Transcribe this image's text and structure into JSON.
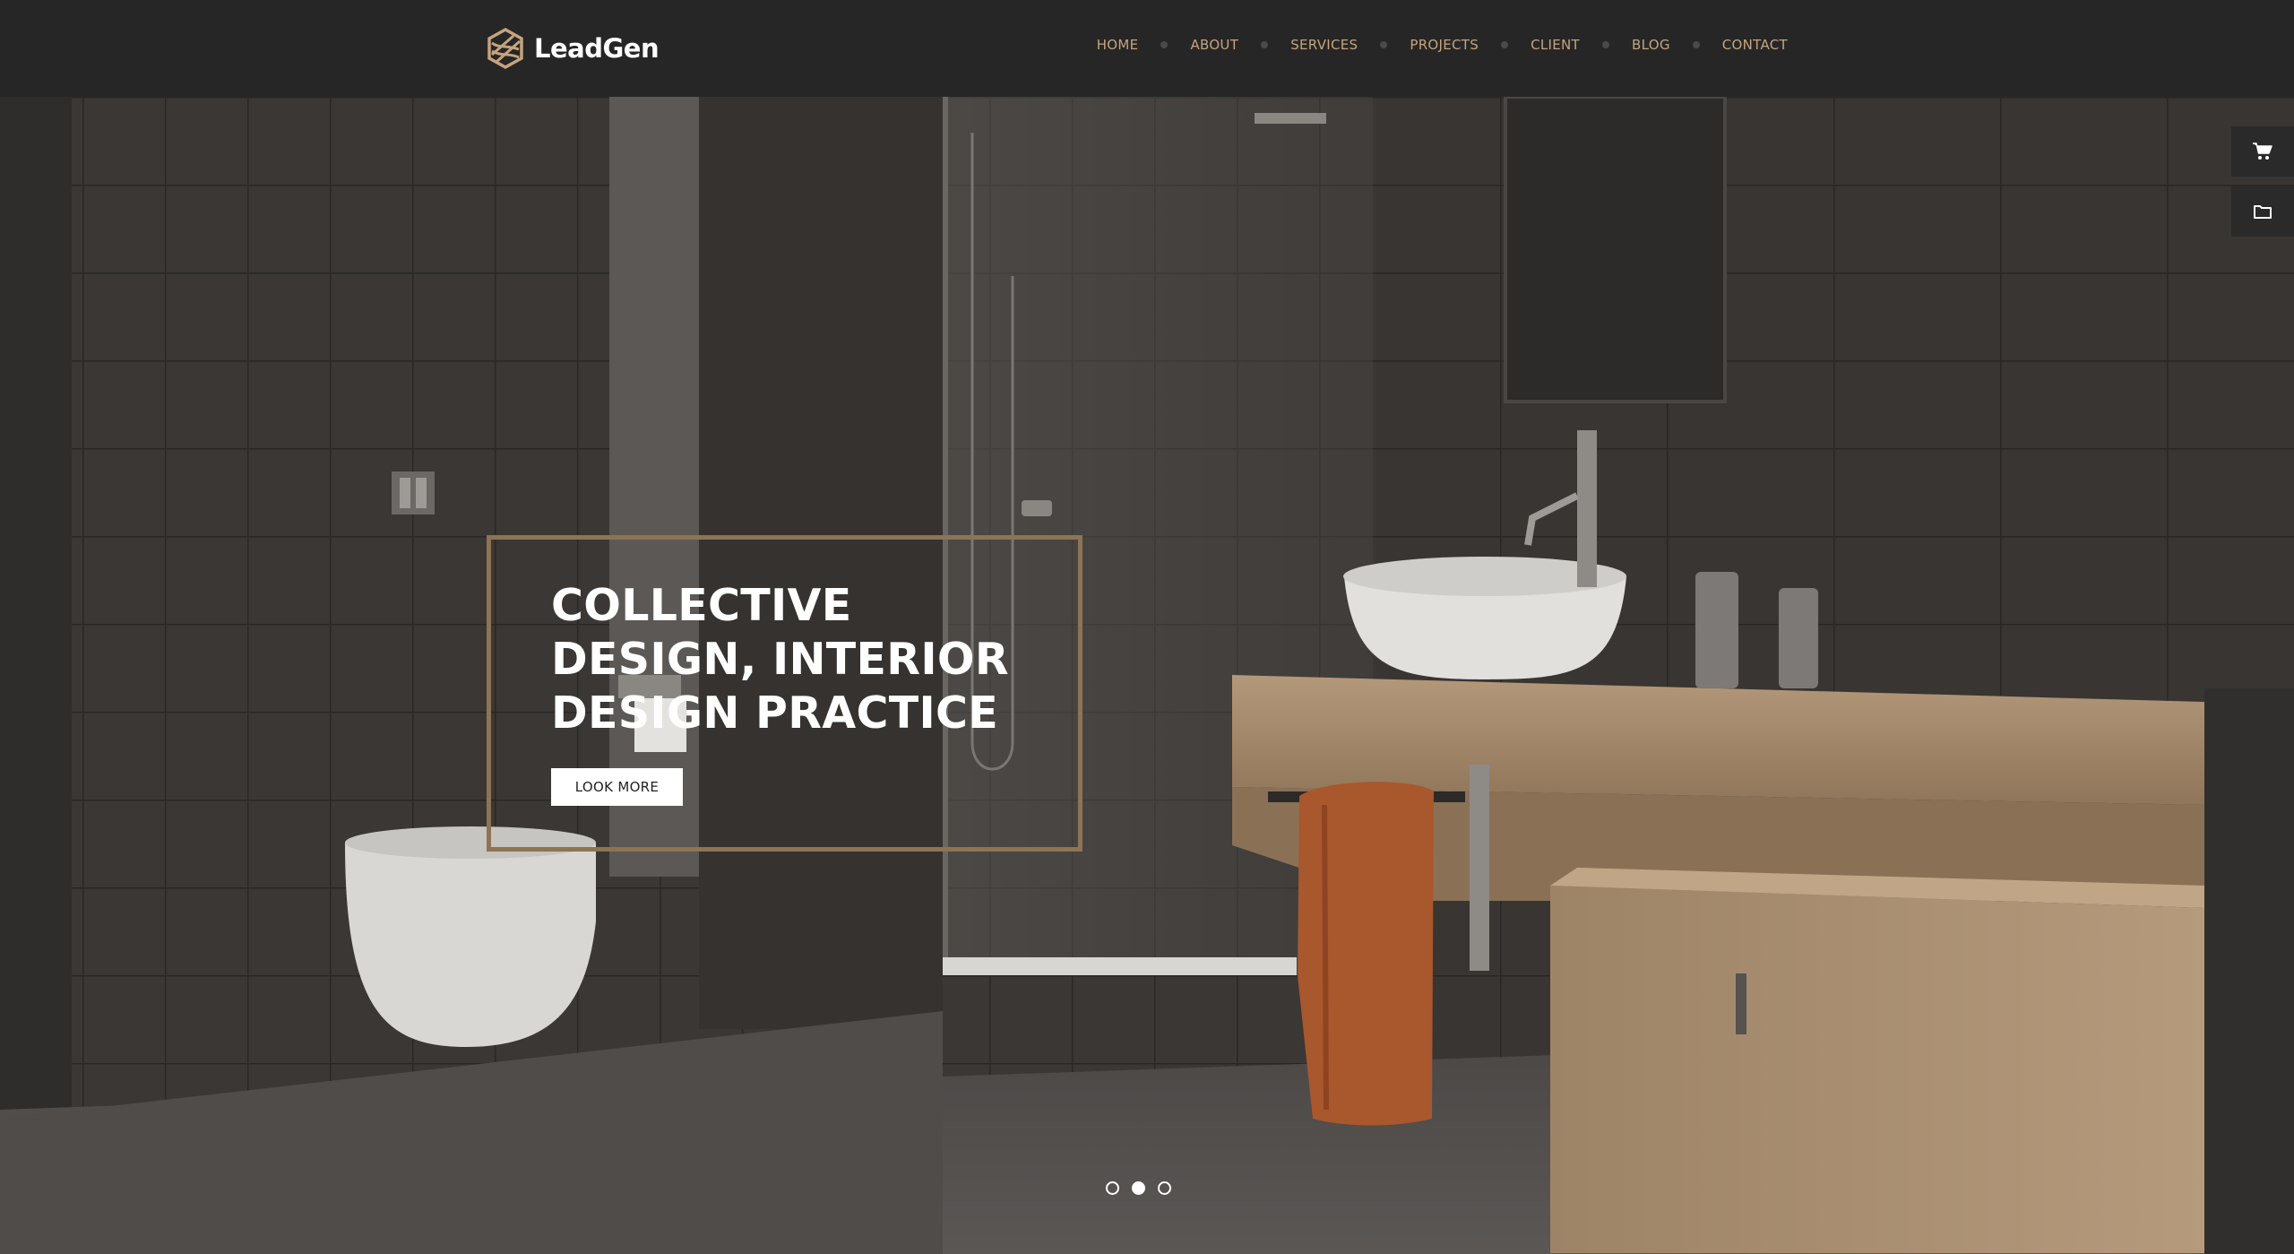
{
  "brand": {
    "name": "LeadGen",
    "icon": "leadgen-logo-icon",
    "accent": "#c5a47e"
  },
  "nav": {
    "items": [
      {
        "label": "HOME"
      },
      {
        "label": "ABOUT"
      },
      {
        "label": "SERVICES"
      },
      {
        "label": "PROJECTS"
      },
      {
        "label": "CLIENT"
      },
      {
        "label": "BLOG"
      },
      {
        "label": "CONTACT"
      }
    ]
  },
  "hero": {
    "headline_lines": [
      "COLLECTIVE",
      "DESIGN, INTERIOR",
      "DESIGN PRACTICE"
    ],
    "cta_label": "LOOK MORE",
    "frame_color": "#8c7455"
  },
  "side_buttons": [
    {
      "icon": "cart-icon"
    },
    {
      "icon": "folder-icon"
    }
  ],
  "slider": {
    "count": 3,
    "active_index": 1
  }
}
